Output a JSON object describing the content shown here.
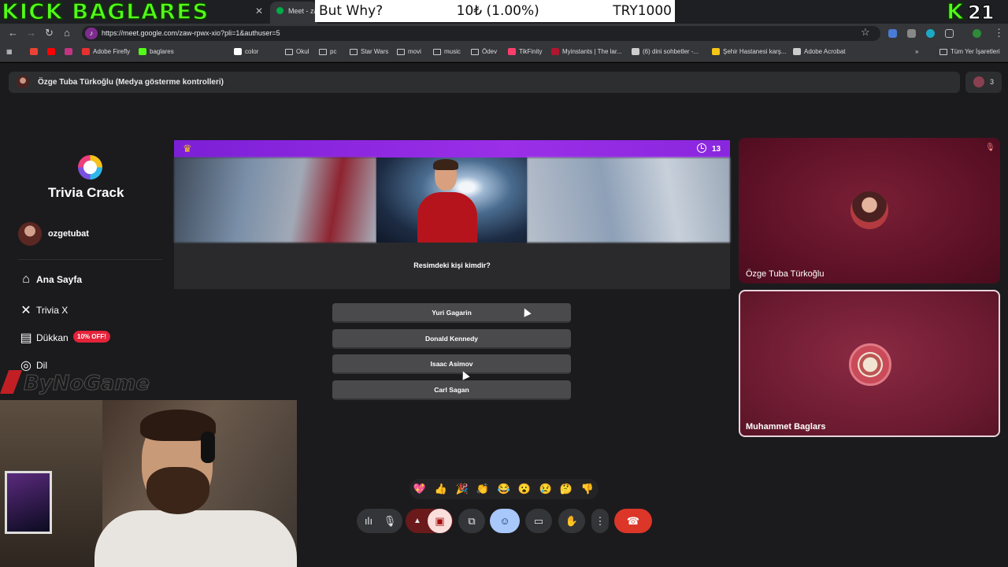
{
  "stream_overlay": {
    "channel_title": "KICK BAGLARES",
    "ticker_label": "But Why?",
    "ticker_amount": "10₺ (1.00%)",
    "ticker_goal": "TRY1000",
    "viewer_count": "21",
    "kick_logo": "K"
  },
  "browser": {
    "active_tab_label": "Meet - za",
    "url": "https://meet.google.com/zaw-rpwx-xio?pli=1&authuser=5",
    "bookmarks": [
      {
        "label": "Adobe Firefly",
        "icon_color": "#e8312f"
      },
      {
        "label": "baglares",
        "icon_color": "#53fc18"
      },
      {
        "label": "color",
        "icon_color": "#ffffff"
      },
      {
        "label": "Okul",
        "icon_color": "folder"
      },
      {
        "label": "pc",
        "icon_color": "folder"
      },
      {
        "label": "Star Wars",
        "icon_color": "folder"
      },
      {
        "label": "movi",
        "icon_color": "folder"
      },
      {
        "label": "music",
        "icon_color": "folder"
      },
      {
        "label": "Ödev",
        "icon_color": "folder"
      },
      {
        "label": "TikFinity",
        "icon_color": "#ff3e6c"
      },
      {
        "label": "Myinstants | The lar...",
        "icon_color": "#b0162e"
      },
      {
        "label": "(6) dini sohbetler -...",
        "icon_color": "#cccccc"
      },
      {
        "label": "Şehir Hastanesi karş...",
        "icon_color": "#f5c518"
      },
      {
        "label": "Adobe Acrobat",
        "icon_color": "#cccccc"
      }
    ],
    "all_bookmarks_label": "Tüm Yer İşaretleri"
  },
  "meet": {
    "banner_text": "Özge Tuba Türkoğlu (Medya gösterme kontrolleri)",
    "participant_count": "3",
    "tiles": [
      {
        "name": "Özge Tuba Türkoğlu"
      },
      {
        "name": "Muhammet Baglars"
      }
    ],
    "reactions": [
      "💖",
      "👍",
      "🎉",
      "👏",
      "😂",
      "😮",
      "😢",
      "🤔",
      "👎"
    ]
  },
  "trivia": {
    "app_name": "Trivia Crack",
    "username": "ozgetubat",
    "menu": [
      {
        "label": "Ana Sayfa",
        "icon": "home-icon"
      },
      {
        "label": "Trivia X",
        "icon": "x-icon"
      },
      {
        "label": "Dükkan",
        "icon": "shop-icon"
      },
      {
        "label": "Dil",
        "icon": "globe-icon"
      }
    ],
    "sale_badge": "10% OFF!",
    "timer": "13",
    "question": "Resimdeki kişi kimdir?",
    "answers": [
      "Yuri Gagarin",
      "Donald Kennedy",
      "Isaac Asimov",
      "Carl Sagan"
    ],
    "watermark": "ByNoGame"
  }
}
